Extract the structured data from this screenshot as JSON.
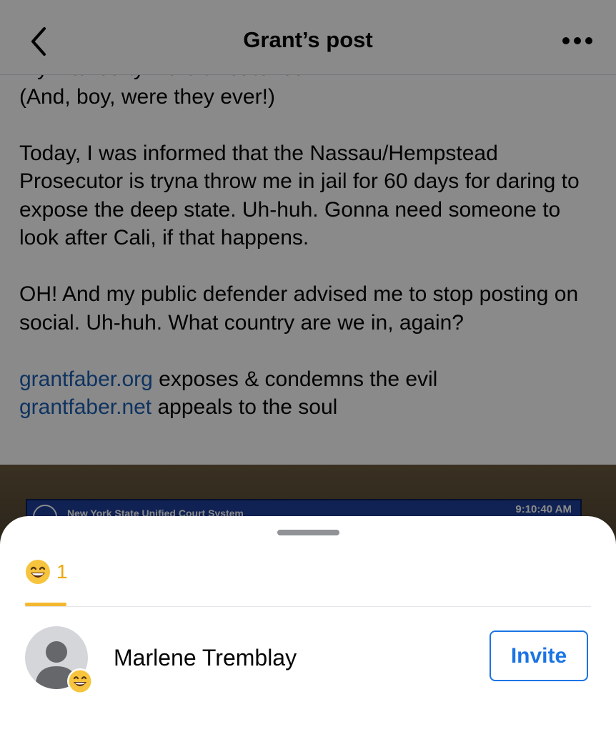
{
  "header": {
    "title": "Grant’s post",
    "back_icon": "chevron-left-icon",
    "more_icon": "more-horizontal-icon"
  },
  "post": {
    "partial_line": "my life/liberty were threatened.",
    "line_after": "(And, boy, were they ever!)",
    "paragraph_2": "Today, I was informed that the Nassau/Hempstead Prosecutor is tryna throw me in jail for 60 days for daring to expose the deep state. Uh-huh. Gonna need someone to look after Cali, if that happens.",
    "paragraph_3": "OH! And my public defender advised me to stop posting on social. Uh-huh. What country are we in, again?",
    "link_1": "grantfaber.org",
    "link_1_text": " exposes & condemns the evil",
    "link_2": "grantfaber.net",
    "link_2_text": " appeals to the soul"
  },
  "photo": {
    "board_title": "New York State Unified Court System",
    "board_time": "9:10:40 AM"
  },
  "reactions_sheet": {
    "tab": {
      "emoji": "laughing-emoji-icon",
      "count": "1"
    },
    "people": [
      {
        "name": "Marlene Tremblay",
        "reaction": "laughing-emoji-icon",
        "action_label": "Invite"
      }
    ]
  },
  "colors": {
    "link": "#1a5fb4",
    "accent": "#1b74e4",
    "tab_accent": "#f4b830"
  }
}
